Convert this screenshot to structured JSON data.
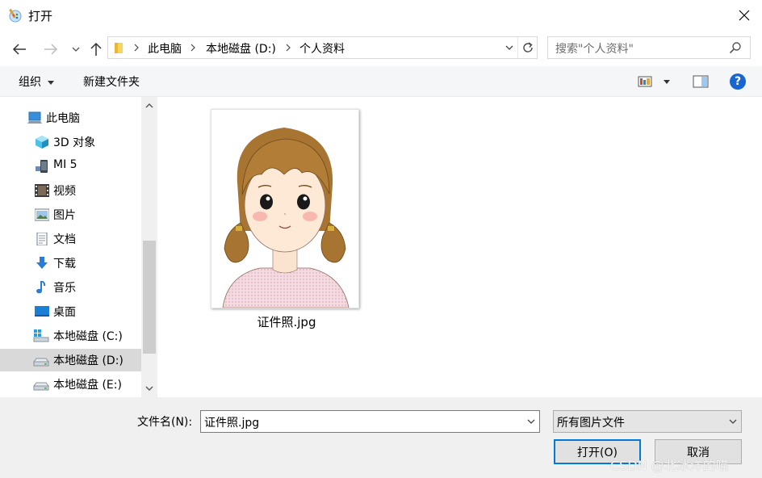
{
  "window": {
    "title": "打开"
  },
  "address": {
    "crumbs": [
      "此电脑",
      "本地磁盘 (D:)",
      "个人资料"
    ]
  },
  "search": {
    "placeholder": "搜索\"个人资料\""
  },
  "toolbar": {
    "organize_label": "组织",
    "newfolder_label": "新建文件夹"
  },
  "nav_pane": {
    "items": [
      {
        "label": "此电脑",
        "icon": "computer-icon"
      },
      {
        "label": "3D 对象",
        "icon": "3d-objects-icon"
      },
      {
        "label": "MI 5",
        "icon": "phone-icon"
      },
      {
        "label": "视频",
        "icon": "video-icon"
      },
      {
        "label": "图片",
        "icon": "pictures-icon"
      },
      {
        "label": "文档",
        "icon": "documents-icon"
      },
      {
        "label": "下载",
        "icon": "download-icon"
      },
      {
        "label": "音乐",
        "icon": "music-icon"
      },
      {
        "label": "桌面",
        "icon": "desktop-icon"
      },
      {
        "label": "本地磁盘 (C:)",
        "icon": "windows-drive-icon"
      },
      {
        "label": "本地磁盘 (D:)",
        "icon": "drive-icon",
        "selected": true
      },
      {
        "label": "本地磁盘 (E:)",
        "icon": "drive-icon"
      }
    ]
  },
  "files": [
    {
      "name": "证件照.jpg",
      "icon": "portrait-thumbnail"
    }
  ],
  "bottom": {
    "filename_label": "文件名(N):",
    "filename_value": "证件照.jpg",
    "filetype_value": "所有图片文件",
    "open_label": "打开(O)",
    "cancel_label": "取消",
    "watermark": "CSDN @北冰洋的喵"
  },
  "colors": {
    "accent": "#0078d7",
    "selected_bg": "#d9d9d9",
    "help": "#1766d1"
  }
}
